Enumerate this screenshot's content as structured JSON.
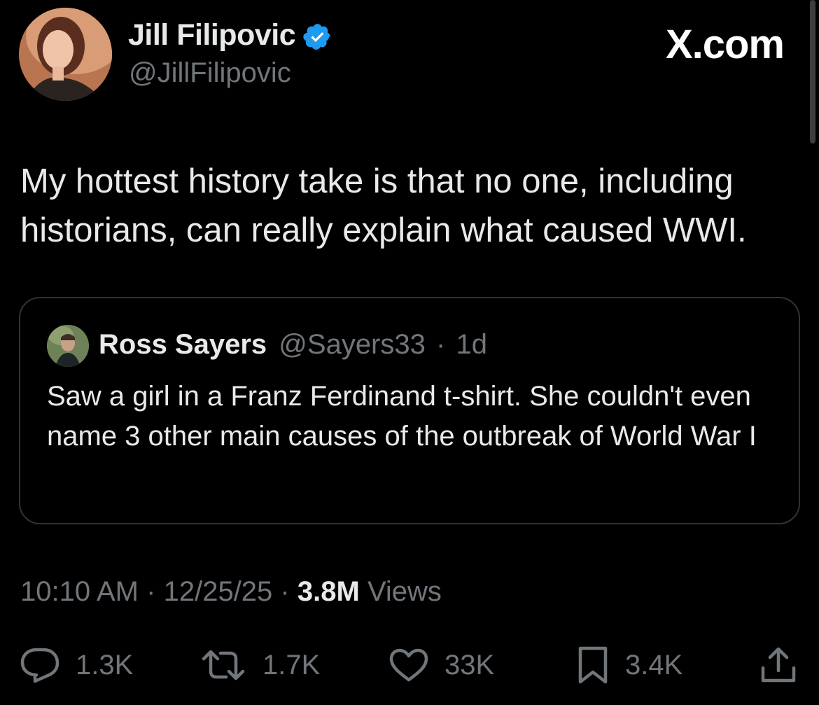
{
  "header": {
    "display_name": "Jill Filipovic",
    "handle": "@JillFilipovic",
    "site_label": "X.com",
    "verified_icon": "verified-badge-icon",
    "verified_color": "#1d9bf0"
  },
  "tweet": {
    "text": "My hottest history take is that no one, including historians, can really explain what caused WWI."
  },
  "quote": {
    "name": "Ross Sayers",
    "handle": "@Sayers33",
    "separator": "·",
    "age": "1d",
    "text": "Saw a girl in a Franz Ferdinand t-shirt. She couldn't even name 3 other main causes of the outbreak of World War I"
  },
  "meta": {
    "time": "10:10 AM",
    "sep1": "·",
    "date": "12/25/25",
    "sep2": "·",
    "views_count": "3.8M",
    "views_label": "Views"
  },
  "actions": {
    "replies": "1.3K",
    "reposts": "1.7K",
    "likes": "33K",
    "bookmarks": "3.4K"
  },
  "colors": {
    "background": "#000000",
    "primary_text": "#e7e9ea",
    "secondary_text": "#71767b",
    "border": "#2f3336"
  }
}
